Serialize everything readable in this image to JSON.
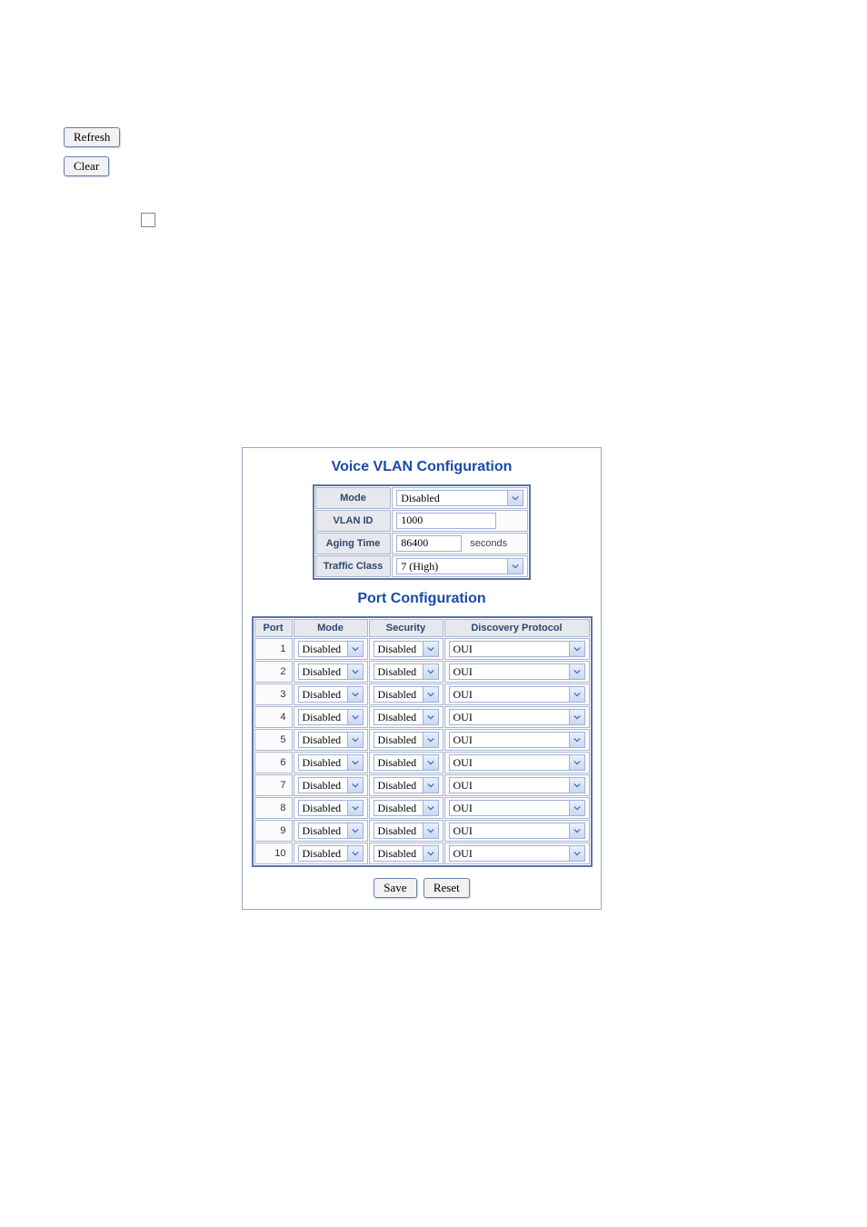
{
  "top": {
    "refresh_label": "Refresh",
    "clear_label": "Clear"
  },
  "voice_vlan": {
    "title": "Voice VLAN Configuration",
    "rows": {
      "mode_label": "Mode",
      "mode_value": "Disabled",
      "vlan_id_label": "VLAN ID",
      "vlan_id_value": "1000",
      "aging_label": "Aging Time",
      "aging_value": "86400",
      "aging_unit": "seconds",
      "traffic_label": "Traffic Class",
      "traffic_value": "7 (High)"
    }
  },
  "port_cfg": {
    "title": "Port Configuration",
    "headers": {
      "port": "Port",
      "mode": "Mode",
      "security": "Security",
      "discovery": "Discovery Protocol"
    },
    "rows": [
      {
        "port": "1",
        "mode": "Disabled",
        "security": "Disabled",
        "discovery": "OUI"
      },
      {
        "port": "2",
        "mode": "Disabled",
        "security": "Disabled",
        "discovery": "OUI"
      },
      {
        "port": "3",
        "mode": "Disabled",
        "security": "Disabled",
        "discovery": "OUI"
      },
      {
        "port": "4",
        "mode": "Disabled",
        "security": "Disabled",
        "discovery": "OUI"
      },
      {
        "port": "5",
        "mode": "Disabled",
        "security": "Disabled",
        "discovery": "OUI"
      },
      {
        "port": "6",
        "mode": "Disabled",
        "security": "Disabled",
        "discovery": "OUI"
      },
      {
        "port": "7",
        "mode": "Disabled",
        "security": "Disabled",
        "discovery": "OUI"
      },
      {
        "port": "8",
        "mode": "Disabled",
        "security": "Disabled",
        "discovery": "OUI"
      },
      {
        "port": "9",
        "mode": "Disabled",
        "security": "Disabled",
        "discovery": "OUI"
      },
      {
        "port": "10",
        "mode": "Disabled",
        "security": "Disabled",
        "discovery": "OUI"
      }
    ]
  },
  "buttons": {
    "save": "Save",
    "reset": "Reset"
  }
}
